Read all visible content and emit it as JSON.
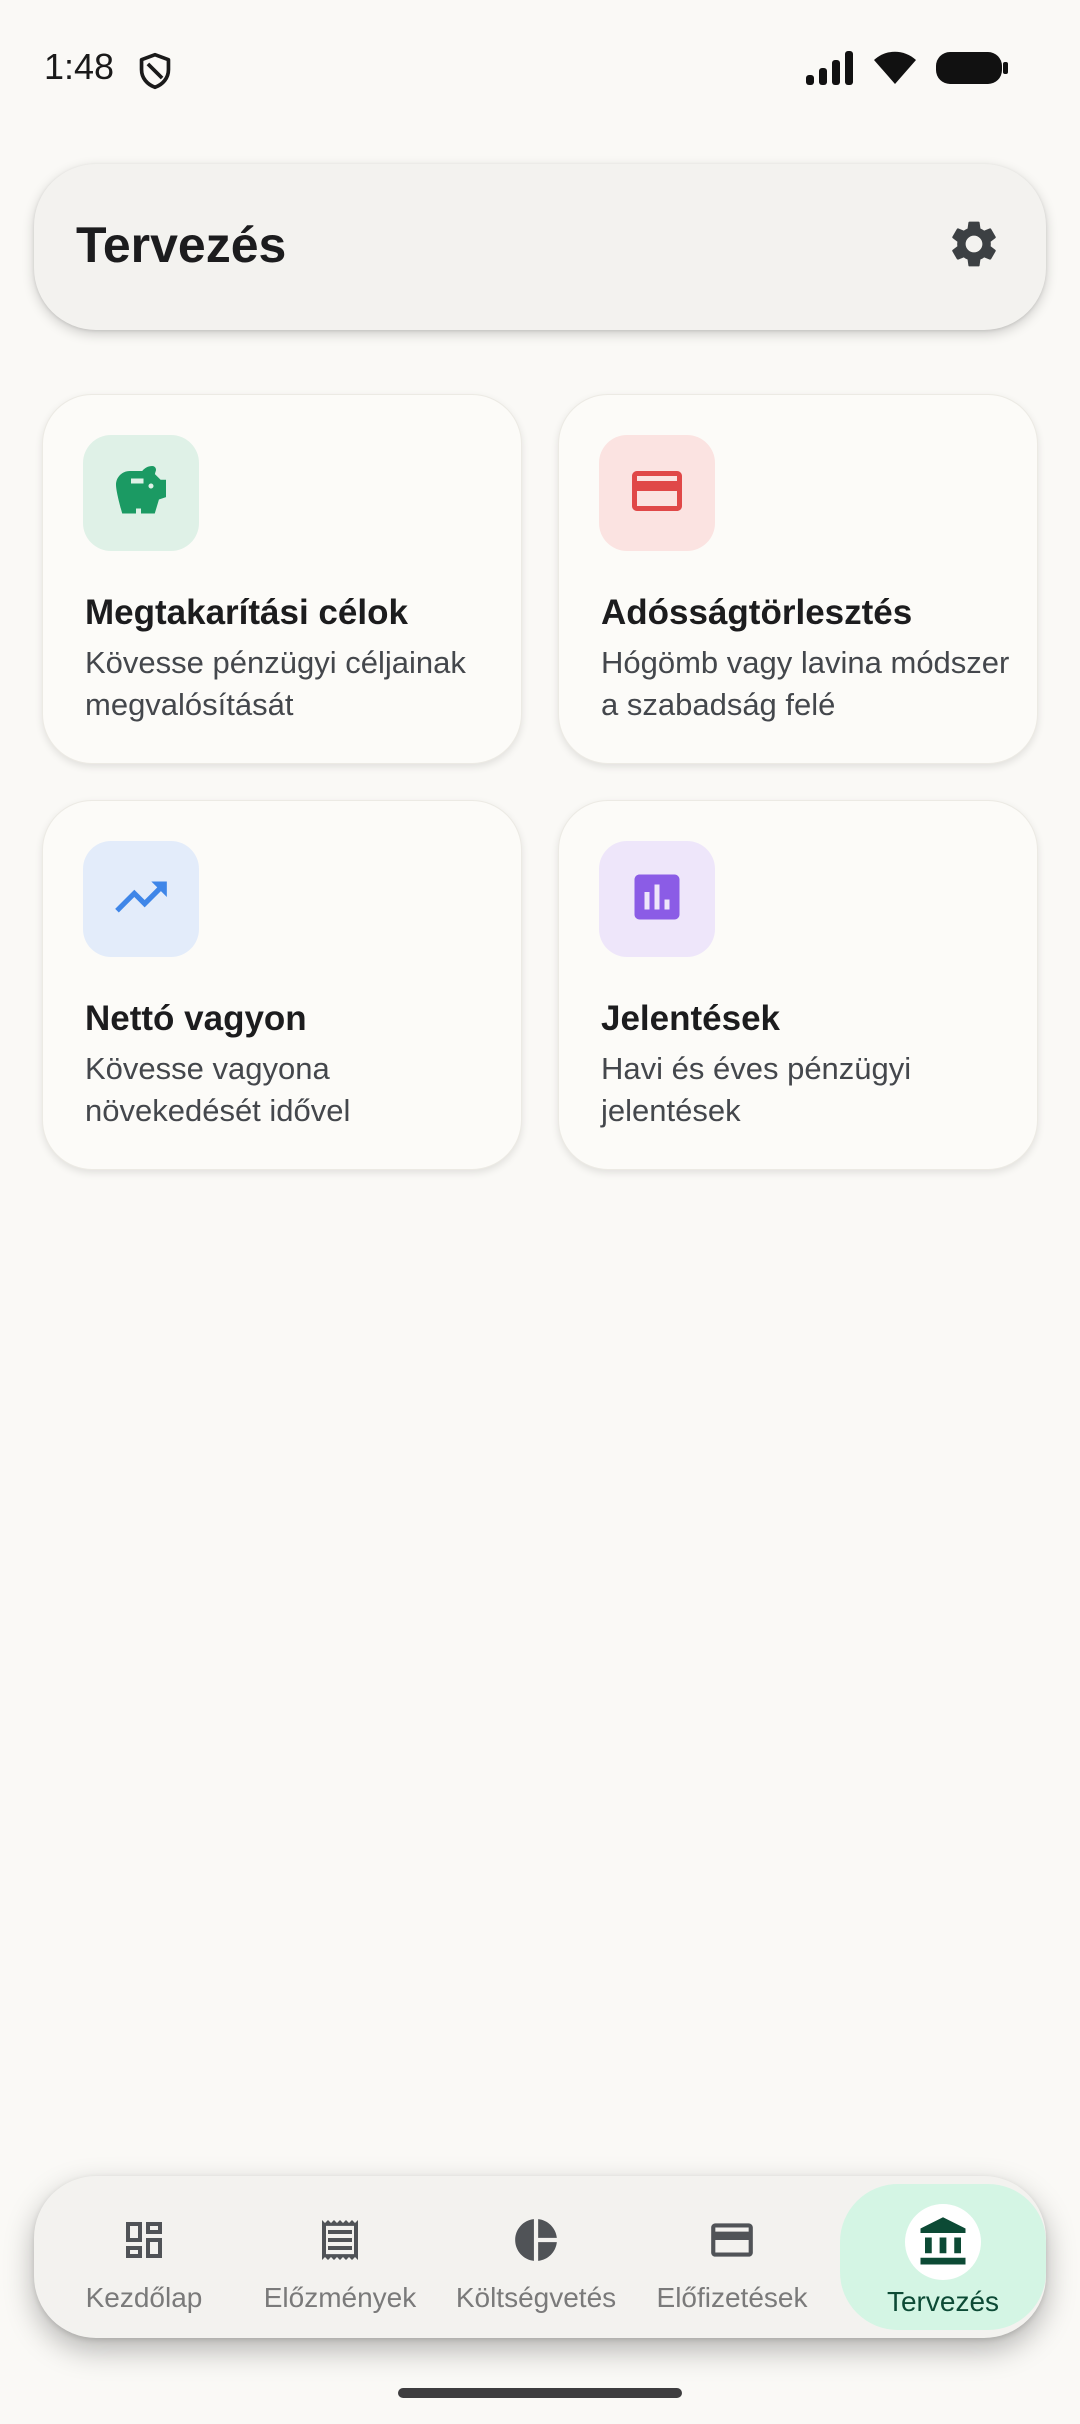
{
  "status_bar": {
    "time": "1:48"
  },
  "header": {
    "title": "Tervezés"
  },
  "cards": [
    {
      "title": "Megtakarítási célok",
      "description": "Kövesse pénzügyi céljainak megvalósítását",
      "icon": "piggy-bank-icon",
      "icon_color": "#1B9A63",
      "icon_bg": "#DFF1E7"
    },
    {
      "title": "Adósságtörlesztés",
      "description": "Hógömb vagy lavina módszer a szabadság felé",
      "icon": "credit-card-icon",
      "icon_color": "#E04848",
      "icon_bg": "#FBE3E1"
    },
    {
      "title": "Nettó vagyon",
      "description": "Kövesse vagyona növekedését idővel",
      "icon": "trending-up-icon",
      "icon_color": "#3F86E8",
      "icon_bg": "#E3ECFA"
    },
    {
      "title": "Jelentések",
      "description": "Havi és éves pénzügyi jelentések",
      "icon": "bar-chart-icon",
      "icon_color": "#8B5CE6",
      "icon_bg": "#EEE6FA"
    }
  ],
  "bottom_nav": {
    "items": [
      {
        "label": "Kezdőlap",
        "icon": "dashboard-icon"
      },
      {
        "label": "Előzmények",
        "icon": "receipt-icon"
      },
      {
        "label": "Költségvetés",
        "icon": "pie-chart-icon"
      },
      {
        "label": "Előfizetések",
        "icon": "credit-card-icon"
      },
      {
        "label": "Tervezés",
        "icon": "bank-icon",
        "active": true
      }
    ],
    "active_color": "#0C4A35",
    "active_bg": "#D4F5E4"
  }
}
